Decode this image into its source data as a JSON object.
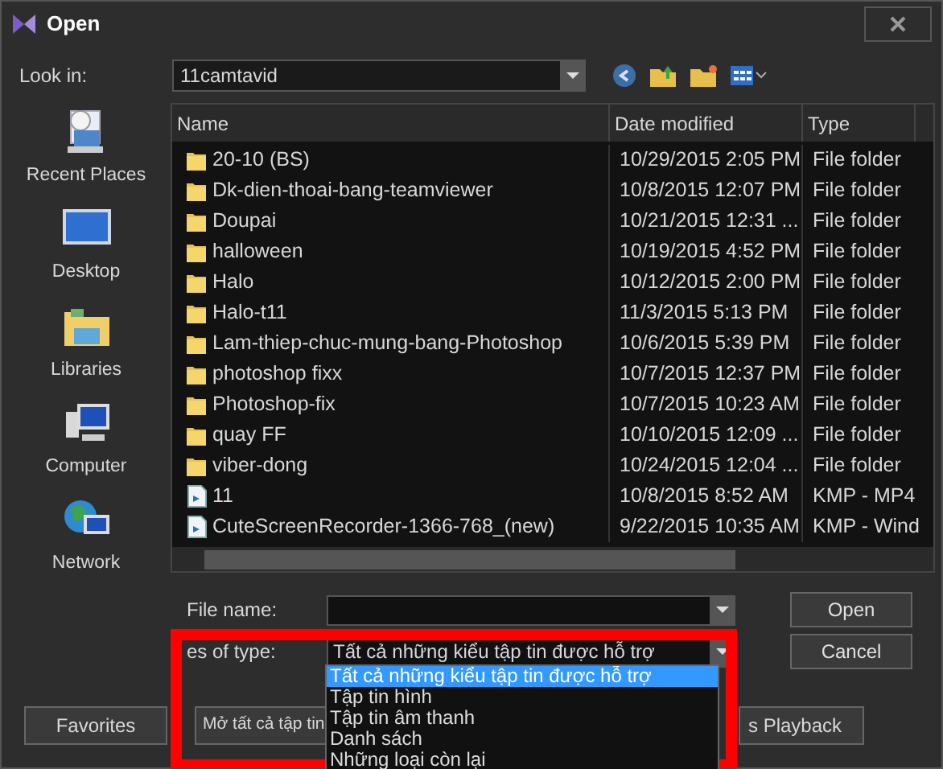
{
  "window": {
    "title": "Open"
  },
  "look_in": {
    "label": "Look in:",
    "value": "11camtavid"
  },
  "places": [
    {
      "label": "Recent Places",
      "kind": "recent"
    },
    {
      "label": "Desktop",
      "kind": "desktop"
    },
    {
      "label": "Libraries",
      "kind": "libraries"
    },
    {
      "label": "Computer",
      "kind": "computer"
    },
    {
      "label": "Network",
      "kind": "network"
    }
  ],
  "file_list": {
    "columns": [
      "Name",
      "Date modified",
      "Type"
    ],
    "rows": [
      {
        "name": "20-10 (BS)",
        "date": "10/29/2015 2:05 PM",
        "type": "File folder",
        "kind": "folder"
      },
      {
        "name": "Dk-dien-thoai-bang-teamviewer",
        "date": "10/8/2015 12:07 PM",
        "type": "File folder",
        "kind": "folder"
      },
      {
        "name": "Doupai",
        "date": "10/21/2015 12:31 ...",
        "type": "File folder",
        "kind": "folder"
      },
      {
        "name": "halloween",
        "date": "10/19/2015 4:52 PM",
        "type": "File folder",
        "kind": "folder"
      },
      {
        "name": "Halo",
        "date": "10/12/2015 2:00 PM",
        "type": "File folder",
        "kind": "folder"
      },
      {
        "name": "Halo-t11",
        "date": "11/3/2015 5:13 PM",
        "type": "File folder",
        "kind": "folder"
      },
      {
        "name": "Lam-thiep-chuc-mung-bang-Photoshop",
        "date": "10/6/2015 5:39 PM",
        "type": "File folder",
        "kind": "folder"
      },
      {
        "name": "photoshop fixx",
        "date": "10/7/2015 12:37 PM",
        "type": "File folder",
        "kind": "folder"
      },
      {
        "name": "Photoshop-fix",
        "date": "10/7/2015 10:23 AM",
        "type": "File folder",
        "kind": "folder"
      },
      {
        "name": "quay FF",
        "date": "10/10/2015 12:09 ...",
        "type": "File folder",
        "kind": "folder"
      },
      {
        "name": "viber-dong",
        "date": "10/24/2015 12:04 ...",
        "type": "File folder",
        "kind": "folder"
      },
      {
        "name": "11",
        "date": "10/8/2015 8:52 AM",
        "type": "KMP - MP4",
        "kind": "file"
      },
      {
        "name": "CuteScreenRecorder-1366-768_(new)",
        "date": "9/22/2015 10:35 AM",
        "type": "KMP - Wind",
        "kind": "file"
      }
    ]
  },
  "file_name": {
    "label": "File name:"
  },
  "files_of_type": {
    "label": "es of type:",
    "value": "Tất cả những kiểu tập tin được hỗ trợ",
    "options": [
      {
        "label": "Tất cả những kiểu tập tin được hỗ trợ",
        "selected": true
      },
      {
        "label": "Tập tin hình",
        "selected": false
      },
      {
        "label": "Tập tin âm thanh",
        "selected": false
      },
      {
        "label": "Danh sách",
        "selected": false
      },
      {
        "label": "Những loại còn lại",
        "selected": false
      }
    ]
  },
  "buttons": [
    "Open",
    "Cancel"
  ],
  "bottom_buttons": [
    "Favorites",
    "Mở tất cả tập tin",
    "s Playback"
  ]
}
